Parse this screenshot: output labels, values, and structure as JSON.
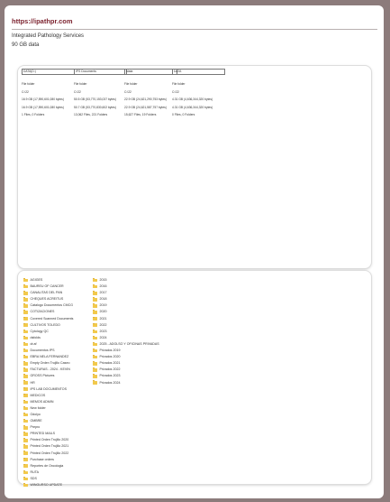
{
  "header": {
    "url": "https://ipathpr.com",
    "org": "Integrated Pathology Services",
    "size": "90 GB data"
  },
  "drives": [
    {
      "name": "DATA(D:)",
      "label": "File folder",
      "path": "C:\\22",
      "capacity": "16.9 GB (17,590,601,080 bytes)",
      "size_on_disk": "16.9 GB (17,590,601,080 bytes)",
      "contains": "1 Files, 0 Folders"
    },
    {
      "name": "IPS Documents",
      "label": "File folder",
      "path": "C:\\22",
      "capacity": "50.5 GB (53,770,153,037 bytes)",
      "size_on_disk": "50.7 GB (53,770,830,602 bytes)",
      "contains": "13,062 Files, 221 Folders"
    },
    {
      "name": "Idata",
      "label": "File folder",
      "path": "C:\\22",
      "capacity": "22.9 GB (24,621,290,753 bytes)",
      "size_on_disk": "22.9 GB (24,621,587,757 bytes)",
      "contains": "15,627 Files, 19 Folders"
    },
    {
      "name": "DATA",
      "label": "File folder",
      "path": "C:\\22",
      "capacity": "4.31 GB (4,636,344,320 bytes)",
      "size_on_disk": "4.31 GB (4,636,344,320 bytes)",
      "contains": "0 Files, 0 Folders"
    }
  ],
  "folders_left": [
    "AGIGES",
    "BAUREU OF CANCER",
    "CANALITAS DEL PAN",
    "CHEQUES ACREITUS",
    "Catalogo Documentos CMCG",
    "COTIZACIONES",
    "Covered Scanned Documents",
    "CULTIVOS TOLEDO",
    "Cytology QC",
    "dsfolds",
    "dr.af",
    "Documentos IPS",
    "EBRA NELA FERNANDEZ",
    "Empty Orden Trujillo Caseo",
    "FACTURAS - 2024 - KEVIN",
    "GROSS Pictures",
    "HR",
    "IPS LAB DOCUMENTOS",
    "MEDICOS",
    "MEMOS ADMIN",
    "New folder",
    "Odolyo",
    "OMBRE",
    "Prepro",
    "PRINTED MAILS",
    "Printed Orden Trujillo 2020",
    "Printed Orden Trujillo 2021",
    "Printed Orden Trujillo 2022",
    "Purchase orders",
    "Reportes de Oncologia",
    "RUTA",
    "SDS",
    "WINGURSO UPDATE"
  ],
  "folders_right": [
    "2015",
    "2016",
    "2017",
    "2018",
    "2019",
    "2020",
    "2021",
    "2022",
    "2023",
    "2024",
    "2025 - ADOLSO Y OFICINAS PRIVADAS",
    "Privados 2019",
    "Privados 2020",
    "Privados 2021",
    "Privados 2022",
    "Privados 2023",
    "Privados 2024"
  ]
}
